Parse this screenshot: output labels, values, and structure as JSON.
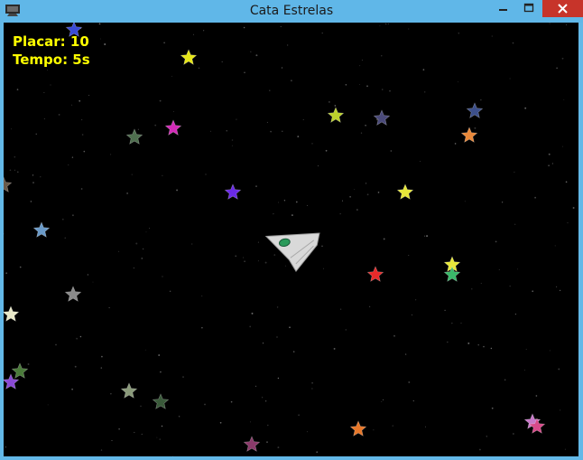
{
  "window": {
    "title": "Cata Estrelas"
  },
  "hud": {
    "score_label": "Placar: 10",
    "time_label": "Tempo: 5s"
  },
  "colors": {
    "hud_text": "#ffff00",
    "background": "#000000",
    "titlebar": "#60b7e8",
    "close_button": "#c7342a"
  },
  "icons": {
    "app": "app-icon",
    "minimize": "minimize-icon",
    "maximize": "maximize-icon",
    "close": "close-icon",
    "player": "spaceship",
    "collectible": "star"
  }
}
